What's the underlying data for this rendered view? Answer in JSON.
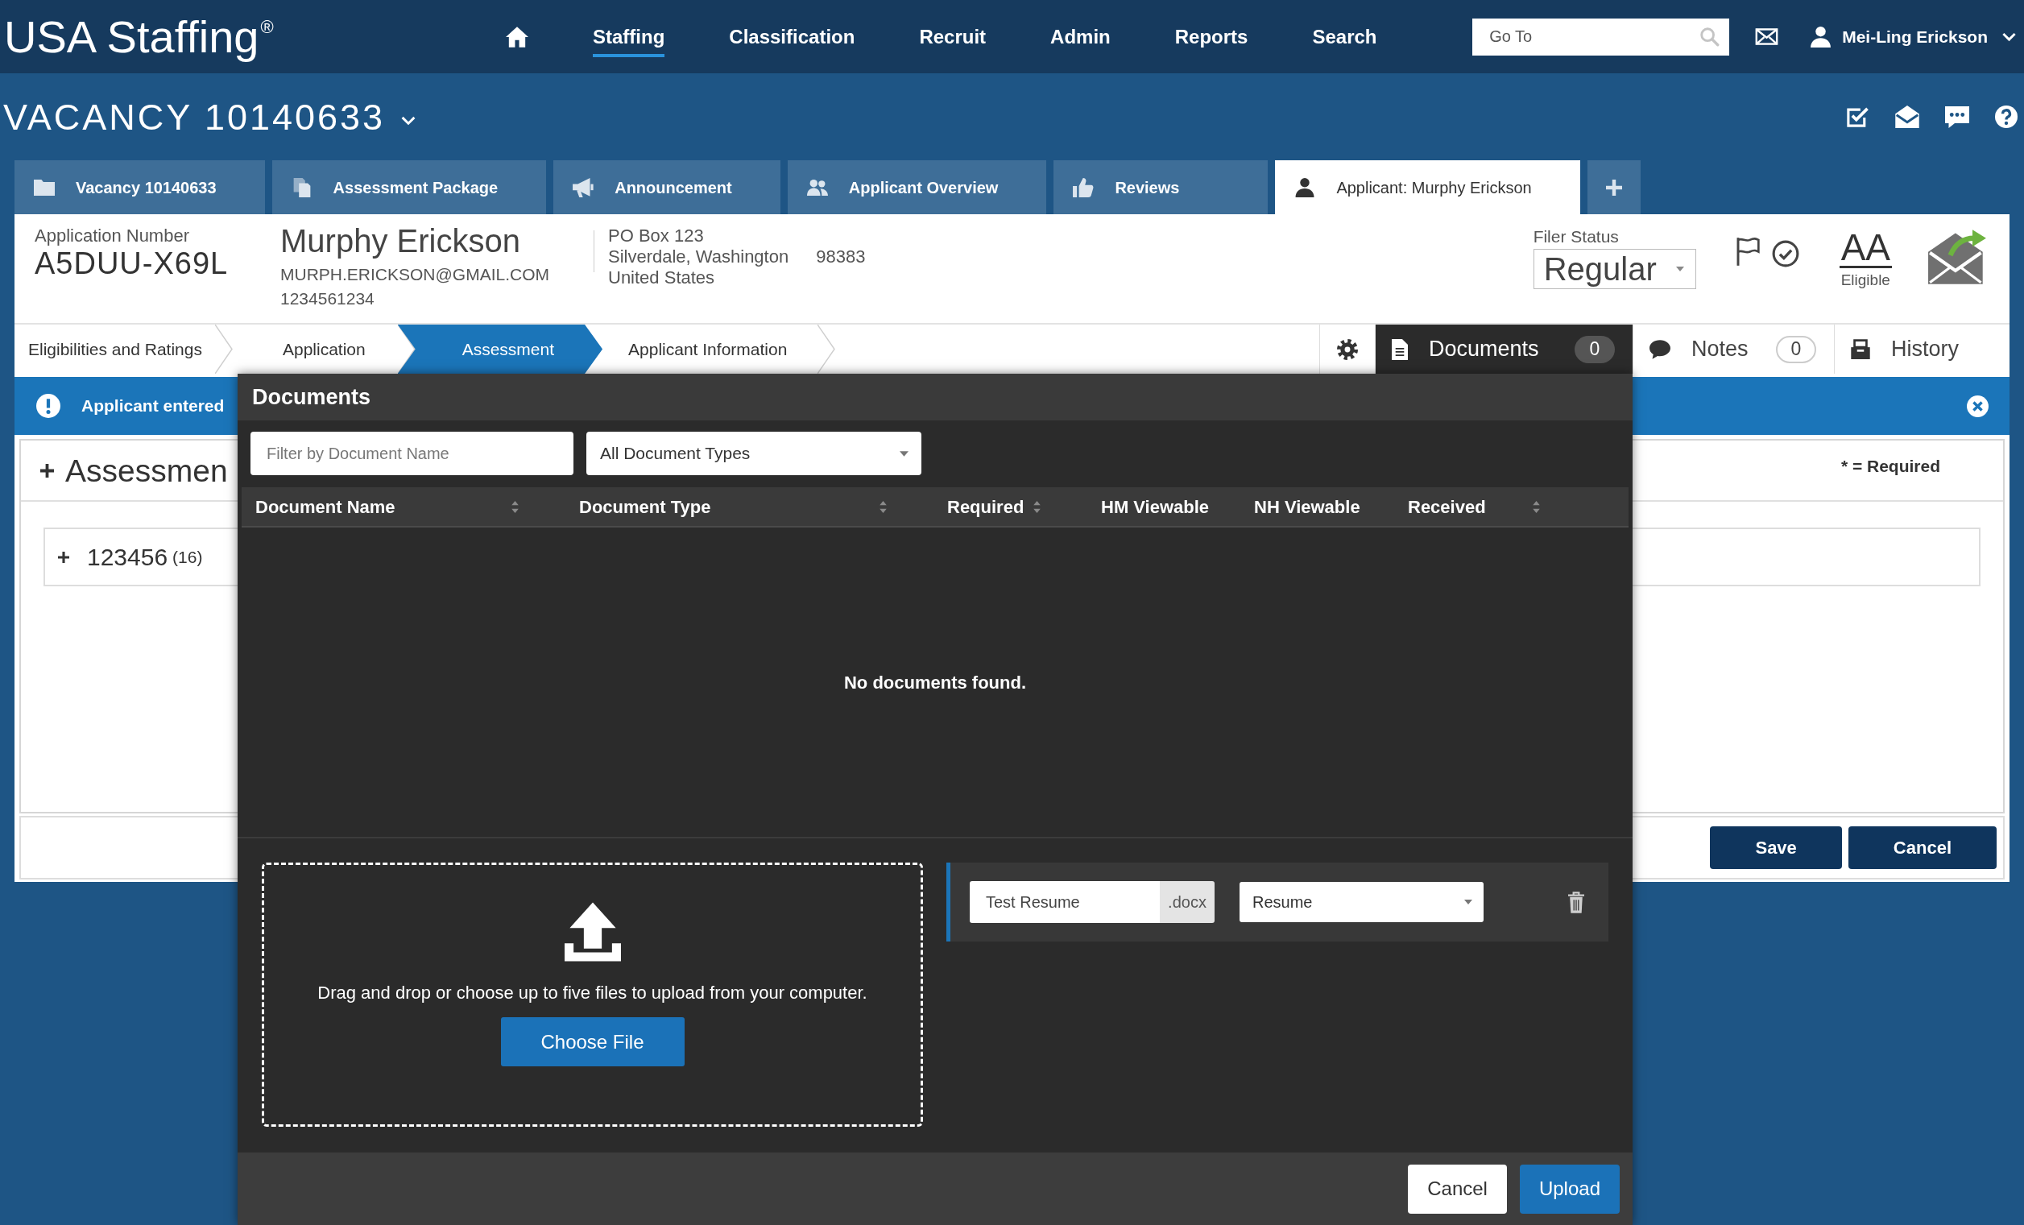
{
  "header": {
    "logo": "USA Staffing$^{®}$",
    "nav": [
      {
        "label": "Staffing",
        "selected": true
      },
      {
        "label": "Classification",
        "selected": false
      },
      {
        "label": "Recruit",
        "selected": false
      },
      {
        "label": "Admin",
        "selected": false
      },
      {
        "label": "Reports",
        "selected": false
      },
      {
        "label": "Search",
        "selected": false
      }
    ],
    "goto_field": {
      "placeholder": "Go To"
    },
    "user": {
      "name": "Mei-Ling Erickson"
    }
  },
  "vacancy": {
    "title": "VACANCY 10140633"
  },
  "tabs": [
    {
      "label": "Vacancy 10140633",
      "selected": false
    },
    {
      "label": "Assessment Package",
      "selected": false
    },
    {
      "label": "Announcement",
      "selected": false
    },
    {
      "label": "Applicant Overview",
      "selected": false
    },
    {
      "label": "Reviews",
      "selected": false
    },
    {
      "label": "Applicant: Murphy Erickson",
      "selected": true
    }
  ],
  "applicant": {
    "number_label": "Application Number",
    "number": "A5DUU-X69L",
    "name": "Murphy Erickson",
    "email": "MURPH.ERICKSON@GMAIL.COM",
    "phone": "1234561234",
    "address": {
      "street": "PO Box 123",
      "city_state": "Silverdale, Washington",
      "zip": "98383",
      "country": "United States"
    },
    "filer_status": {
      "label": "Filer Status",
      "value": "Regular"
    },
    "eligibility": {
      "code": "AA",
      "label": "Eligible"
    }
  },
  "steps": [
    {
      "label": "Eligibilities and Ratings",
      "selected": false
    },
    {
      "label": "Application",
      "selected": false
    },
    {
      "label": "Assessment",
      "selected": true
    },
    {
      "label": "Applicant Information",
      "selected": false
    }
  ],
  "side_tabs": [
    {
      "label": "Documents",
      "count": "0",
      "selected": true
    },
    {
      "label": "Notes",
      "count": "0",
      "selected": false
    },
    {
      "label": "History",
      "selected": false
    }
  ],
  "alert": {
    "text": "Applicant entered"
  },
  "assessment": {
    "title": "Assessmen",
    "expanded": false,
    "required_note": "* = Required",
    "groups": [
      {
        "code": "123456",
        "count": "(16)",
        "expanded": false
      }
    ]
  },
  "form_buttons": [
    {
      "label": "Save"
    },
    {
      "label": "Cancel"
    }
  ],
  "modal": {
    "title": "Documents",
    "filter": {
      "placeholder": "Filter by Document Name"
    },
    "type_filter": {
      "value": "All Document Types"
    },
    "columns": [
      {
        "label": "Document Name",
        "sortable": true
      },
      {
        "label": "Document Type",
        "sortable": true
      },
      {
        "label": "Required",
        "sortable": true
      },
      {
        "label": "HM Viewable",
        "sortable": false
      },
      {
        "label": "NH Viewable",
        "sortable": false
      },
      {
        "label": "Received",
        "sortable": true
      }
    ],
    "empty_message": "No documents found.",
    "dropzone": {
      "text": "Drag and drop or choose up to five files to upload from your computer.",
      "button": "Choose File"
    },
    "files": [
      {
        "name": "Test Resume",
        "extension": ".docx",
        "type": "Resume"
      }
    ],
    "buttons": [
      {
        "label": "Cancel",
        "kind": "secondary"
      },
      {
        "label": "Upload",
        "kind": "primary"
      }
    ]
  }
}
